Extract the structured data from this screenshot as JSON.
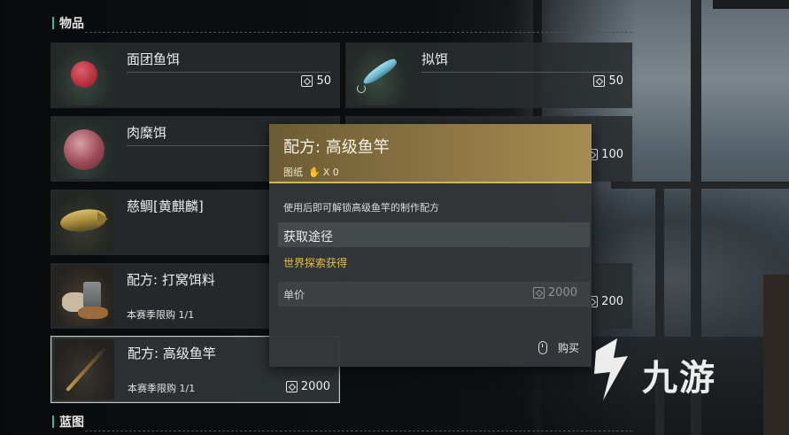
{
  "sections": {
    "items_header": "物品",
    "blueprint_header": "蓝图"
  },
  "items": [
    {
      "name": "面团鱼饵",
      "price": "50",
      "icon": "dough-bait-icon"
    },
    {
      "name": "拟饵",
      "price": "50",
      "icon": "lure-icon"
    },
    {
      "name": "肉糜饵",
      "price": "",
      "icon": "minced-meat-bait-icon"
    },
    {
      "name": "",
      "price": "100",
      "icon": "coin-icon"
    },
    {
      "name": "慈鲷[黄麒麟]",
      "price": "",
      "icon": "cichlid-fish-icon"
    },
    {
      "name": "配方: 打窝饵料",
      "limit": "本赛季限购 1/1",
      "price": "",
      "icon": "groundbait-recipe-icon"
    },
    {
      "name": "",
      "price": "200",
      "icon": "coin-icon"
    },
    {
      "name": "配方: 高级鱼竿",
      "limit": "本赛季限购 1/1",
      "price": "2000",
      "icon": "fishing-rod-icon"
    }
  ],
  "tooltip": {
    "title": "配方: 高级鱼竿",
    "category": "图纸",
    "owned": "X 0",
    "description": "使用后即可解锁高级鱼竿的制作配方",
    "source_label": "获取途径",
    "source_value": "世界探索获得",
    "price_label": "单价",
    "price_value": "2000",
    "buy_label": "购买"
  },
  "logo": {
    "text": "九游"
  },
  "colors": {
    "accent": "#3fb59b",
    "tooltip_header": "#8d7644",
    "tooltip_header_line": "#d5b35a",
    "source_text": "#e2bf47"
  }
}
